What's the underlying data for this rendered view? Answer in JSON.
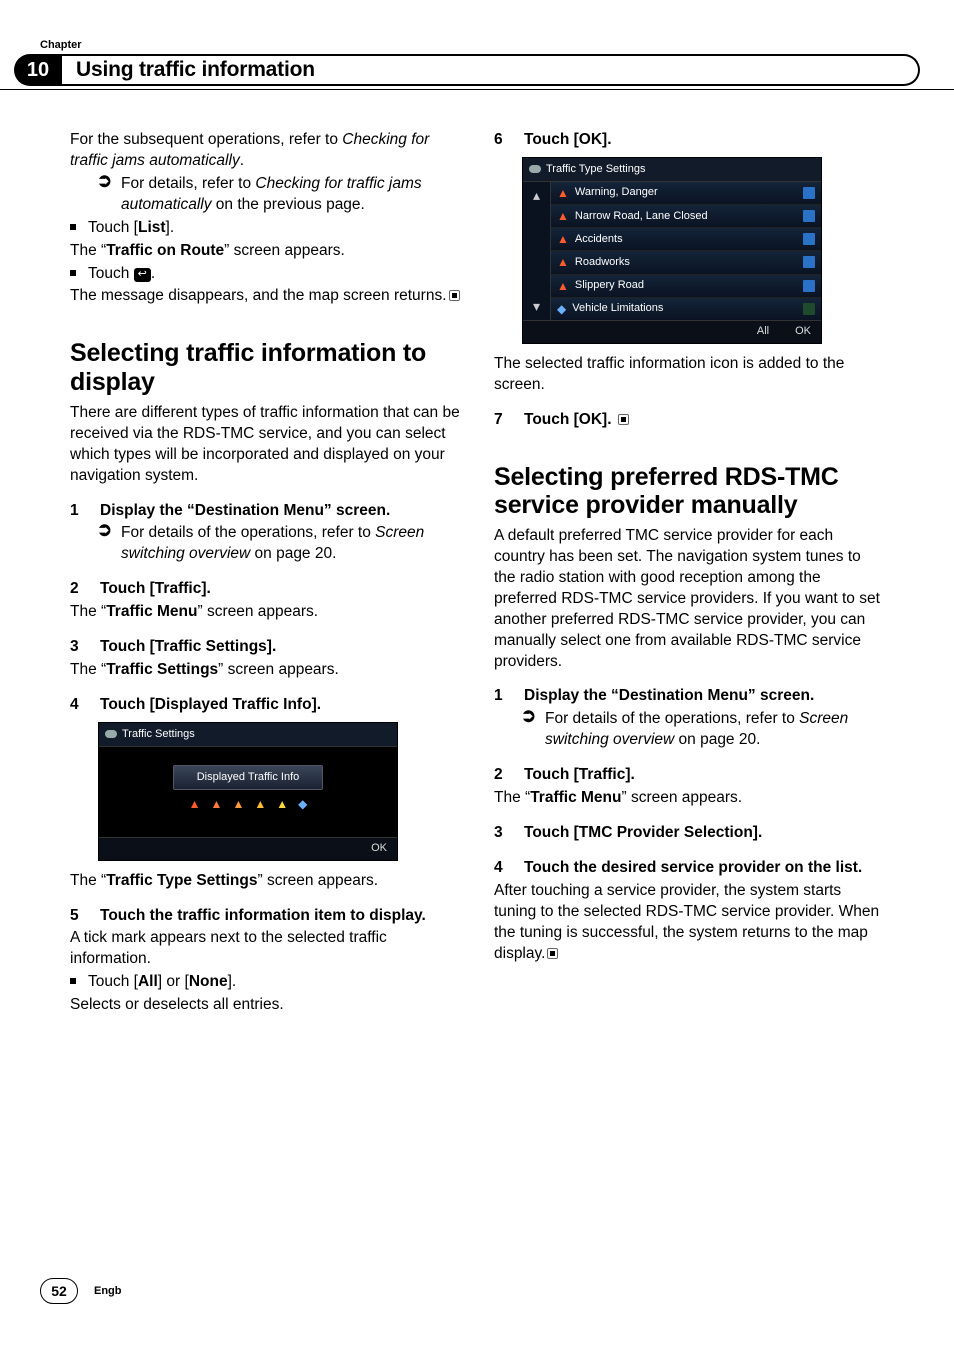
{
  "header": {
    "chapter_label": "Chapter",
    "chapter_number": "10",
    "title": "Using traffic information"
  },
  "left": {
    "intro_prefix": "For the subsequent operations, refer to ",
    "intro_italic": "Checking for traffic jams automatically",
    "intro_suffix": ".",
    "xref1_prefix": "For details, refer to ",
    "xref1_italic": "Checking for traffic jams automatically",
    "xref1_suffix": " on the previous page.",
    "touch_list_pre": "Touch [",
    "touch_list_bold": "List",
    "touch_list_post": "].",
    "traffic_route_pre": "The “",
    "traffic_route_bold": "Traffic on Route",
    "traffic_route_post": "” screen appears.",
    "touch_back": "Touch ",
    "back_symbol": "↩",
    "touch_back_post": ".",
    "msg_disappears": "The message disappears, and the map screen returns.",
    "h2a": "Selecting traffic information to display",
    "h2a_body": "There are different types of traffic information that can be received via the RDS-TMC service, and you can select which types will be incorporated and displayed on your navigation system.",
    "step1": "Display the “Destination Menu” screen.",
    "step1_sub_pre": "For details of the operations, refer to ",
    "step1_sub_italic": "Screen switching overview",
    "step1_sub_post": " on page 20.",
    "step2": "Touch [Traffic].",
    "step2_after_pre": "The “",
    "step2_after_bold": "Traffic Menu",
    "step2_after_post": "” screen appears.",
    "step3": "Touch [Traffic Settings].",
    "step3_after_pre": "The “",
    "step3_after_bold": "Traffic Settings",
    "step3_after_post": "” screen appears.",
    "step4": "Touch [Displayed Traffic Info].",
    "ss1": {
      "title": "Traffic Settings",
      "button": "Displayed Traffic Info",
      "ok": "OK"
    },
    "ss1_after_pre": "The “",
    "ss1_after_bold": "Traffic Type Settings",
    "ss1_after_post": "” screen appears.",
    "step5": "Touch the traffic information item to display.",
    "step5_after": "A tick mark appears next to the selected traffic information.",
    "touch_allnone_pre": "Touch [",
    "touch_all": "All",
    "touch_allnone_mid": "] or [",
    "touch_none": "None",
    "touch_allnone_post": "].",
    "selects": "Selects or deselects all entries."
  },
  "right": {
    "step6": "Touch [OK].",
    "ss2": {
      "title": "Traffic Type Settings",
      "rows": [
        "Warning, Danger",
        "Narrow Road, Lane Closed",
        "Accidents",
        "Roadworks",
        "Slippery Road",
        "Vehicle Limitations"
      ],
      "all": "All",
      "ok": "OK"
    },
    "after_ss2": "The selected traffic information icon is added to the screen.",
    "step7": "Touch [OK].",
    "h2b": "Selecting preferred RDS-TMC service provider manually",
    "h2b_body": "A default preferred TMC service provider for each country has been set. The navigation system tunes to the radio station with good reception among the preferred RDS-TMC service providers. If you want to set another preferred RDS-TMC service provider, you can manually select one from available RDS-TMC service providers.",
    "step1": "Display the “Destination Menu” screen.",
    "step1_sub_pre": "For details of the operations, refer to ",
    "step1_sub_italic": "Screen switching overview",
    "step1_sub_post": " on page 20.",
    "step2": "Touch [Traffic].",
    "step2_after_pre": "The “",
    "step2_after_bold": "Traffic Menu",
    "step2_after_post": "” screen appears.",
    "step3": "Touch [TMC Provider Selection].",
    "step4": "Touch the desired service provider on the list.",
    "step4_after": "After touching a service provider, the system starts tuning to the selected RDS-TMC service provider. When the tuning is successful, the system returns to the map display."
  },
  "footer": {
    "page": "52",
    "lang": "Engb"
  },
  "glyphs": {
    "pointer": "➡",
    "ref_arrow": "➲"
  },
  "chart_data": null
}
